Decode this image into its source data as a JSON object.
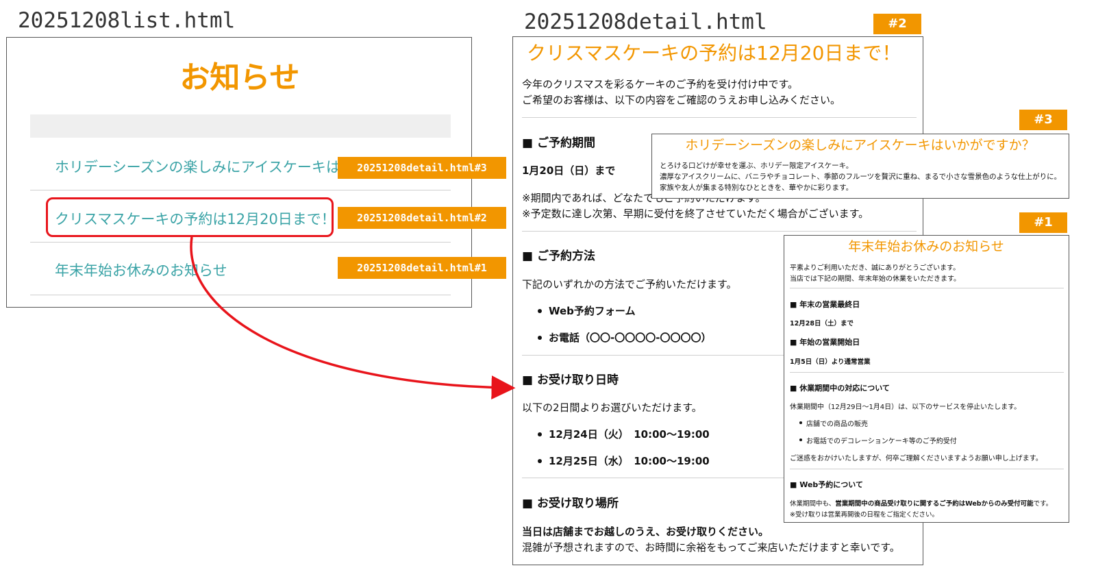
{
  "list_page": {
    "filename": "20251208list.html",
    "heading": "お知らせ",
    "items": [
      {
        "label": "ホリデーシーズンの楽しみにアイスケーキはい",
        "link_tag": "20251208detail.html#3"
      },
      {
        "label": "クリスマスケーキの予約は12月20日まで！",
        "link_tag": "20251208detail.html#2"
      },
      {
        "label": "年末年始お休みのお知らせ",
        "link_tag": "20251208detail.html#1"
      }
    ]
  },
  "detail_page": {
    "filename": "20251208detail.html",
    "tag": "#2",
    "title": "クリスマスケーキの予約は12月20日まで！",
    "intro": [
      "今年のクリスマスを彩るケーキのご予約を受け付け中です。",
      "ご希望のお客様は、以下の内容をご確認のうえお申し込みください。"
    ],
    "section1_heading": "■ ご予約期間",
    "section1_date": "1月20日（日）まで",
    "section1_notes": [
      "※期間内であれば、どなたでもご予約いただけます。",
      "※予定数に達し次第、早期に受付を終了させていただく場合がございます。"
    ],
    "section2_heading": "■ ご予約方法",
    "section2_text": "下記のいずれかの方法でご予約いただけます。",
    "section2_items": [
      "Web予約フォーム",
      "お電話（〇〇-〇〇〇〇-〇〇〇〇）"
    ],
    "section3_heading": "■ お受け取り日時",
    "section3_text": "以下の2日間よりお選びいただけます。",
    "section3_items": [
      "12月24日（火）　10:00〜19:00",
      "12月25日（水）　10:00〜19:00"
    ],
    "section4_heading": "■ お受け取り場所",
    "section4_bold": "当日は店舗までお越しのうえ、お受け取りください。",
    "section4_text": "混雑が予想されますので、お時間に余裕をもってご来店いただけますと幸いです。"
  },
  "detail3": {
    "tag": "#3",
    "title": "ホリデーシーズンの楽しみにアイスケーキはいかがですか？",
    "lines": [
      "とろける口どけが幸せを運ぶ、ホリデー限定アイスケーキ。",
      "濃厚なアイスクリームに、バニラやチョコレート、季節のフルーツを贅沢に重ね、まるで小さな雪景色のような仕上がりに。",
      "家族や友人が集まる特別なひとときを、華やかに彩ります。"
    ]
  },
  "detail1": {
    "tag": "#1",
    "title": "年末年始お休みのお知らせ",
    "intro": [
      "平素よりご利用いただき、誠にありがとうございます。",
      "当店では下記の期間、年末年始の休業をいただきます。"
    ],
    "s1_heading": "■ 年末の営業最終日",
    "s1_text": "12月28日（土）まで",
    "s2_heading": "■ 年始の営業開始日",
    "s2_text": "1月5日（日）より通常営業",
    "s3_heading": "■ 休業期間中の対応について",
    "s3_text": "休業期間中（12月29日〜1月4日）は、以下のサービスを停止いたします。",
    "s3_items": [
      "店舗での商品の販売",
      "お電話でのデコレーションケーキ等のご予約受付"
    ],
    "s3_note": "ご迷惑をおかけいたしますが、何卒ご理解くださいますようお願い申し上げます。",
    "s4_heading": "■ Web予約について",
    "s4_text_a": "休業期間中も、",
    "s4_text_bold": "営業期間中の商品受け取りに関するご予約はWebからのみ受付可能",
    "s4_text_c": "です。",
    "s4_note": "※受け取りは営業再開後の日程をご指定ください。"
  },
  "colors": {
    "accent": "#f29600",
    "link": "#3aa3a6",
    "highlight": "#e8141b"
  }
}
